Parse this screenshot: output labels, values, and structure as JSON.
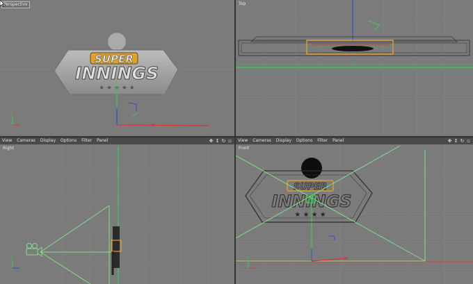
{
  "viewports": {
    "perspective": {
      "label": "Perspective"
    },
    "top": {
      "label": "Top"
    },
    "right": {
      "label": "Right"
    },
    "front": {
      "label": "Front"
    }
  },
  "menubar": {
    "items": [
      "View",
      "Cameras",
      "Display",
      "Options",
      "Filter",
      "Panel"
    ]
  },
  "logo": {
    "line1": "SUPER",
    "line2": "INNINGS"
  },
  "icons": {
    "nav": [
      "move-icon",
      "dolly-icon",
      "rotate-icon",
      "maximize-icon"
    ]
  },
  "colors": {
    "viewport_bg": "#7b7b7b",
    "grid": "#8a8a8a",
    "axis_green": "#3fc95a",
    "axis_red": "#d23a3a",
    "axis_blue": "#3a4ad2",
    "selection_orange": "#f0a020",
    "camera_green": "#7ee08a"
  }
}
